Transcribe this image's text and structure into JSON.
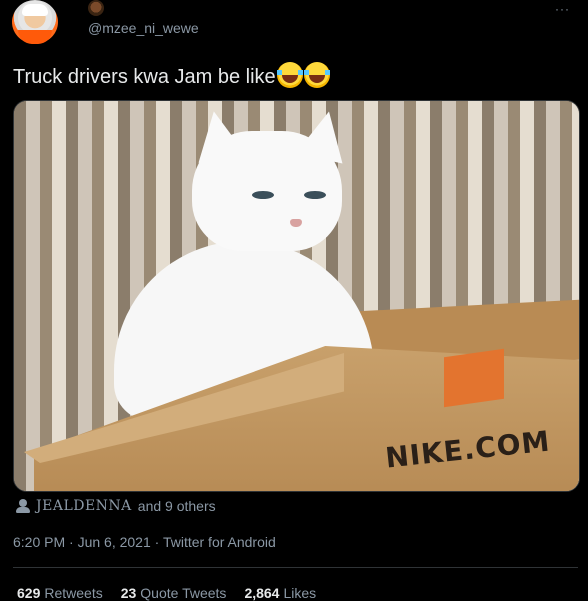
{
  "tweet": {
    "handle": "@mzee_ni_wewe",
    "more_label": "···",
    "text": "Truck drivers kwa Jam be like",
    "emojis": [
      "face-with-tears-of-joy",
      "face-with-tears-of-joy"
    ],
    "image": {
      "box_brand": "NIKE.COM"
    },
    "liked_by": {
      "name": "JEALDENNA",
      "others": "and 9 others"
    },
    "meta": "6:20 PM · Jun 6, 2021 · Twitter for Android",
    "stats": {
      "retweets_count": "629",
      "retweets_label": "Retweets",
      "quotes_count": "23",
      "quotes_label": "Quote Tweets",
      "likes_count": "2,864",
      "likes_label": "Likes"
    }
  },
  "colors": {
    "background": "#000000",
    "text": "#e7e9ea",
    "secondary": "#8b98a5"
  }
}
